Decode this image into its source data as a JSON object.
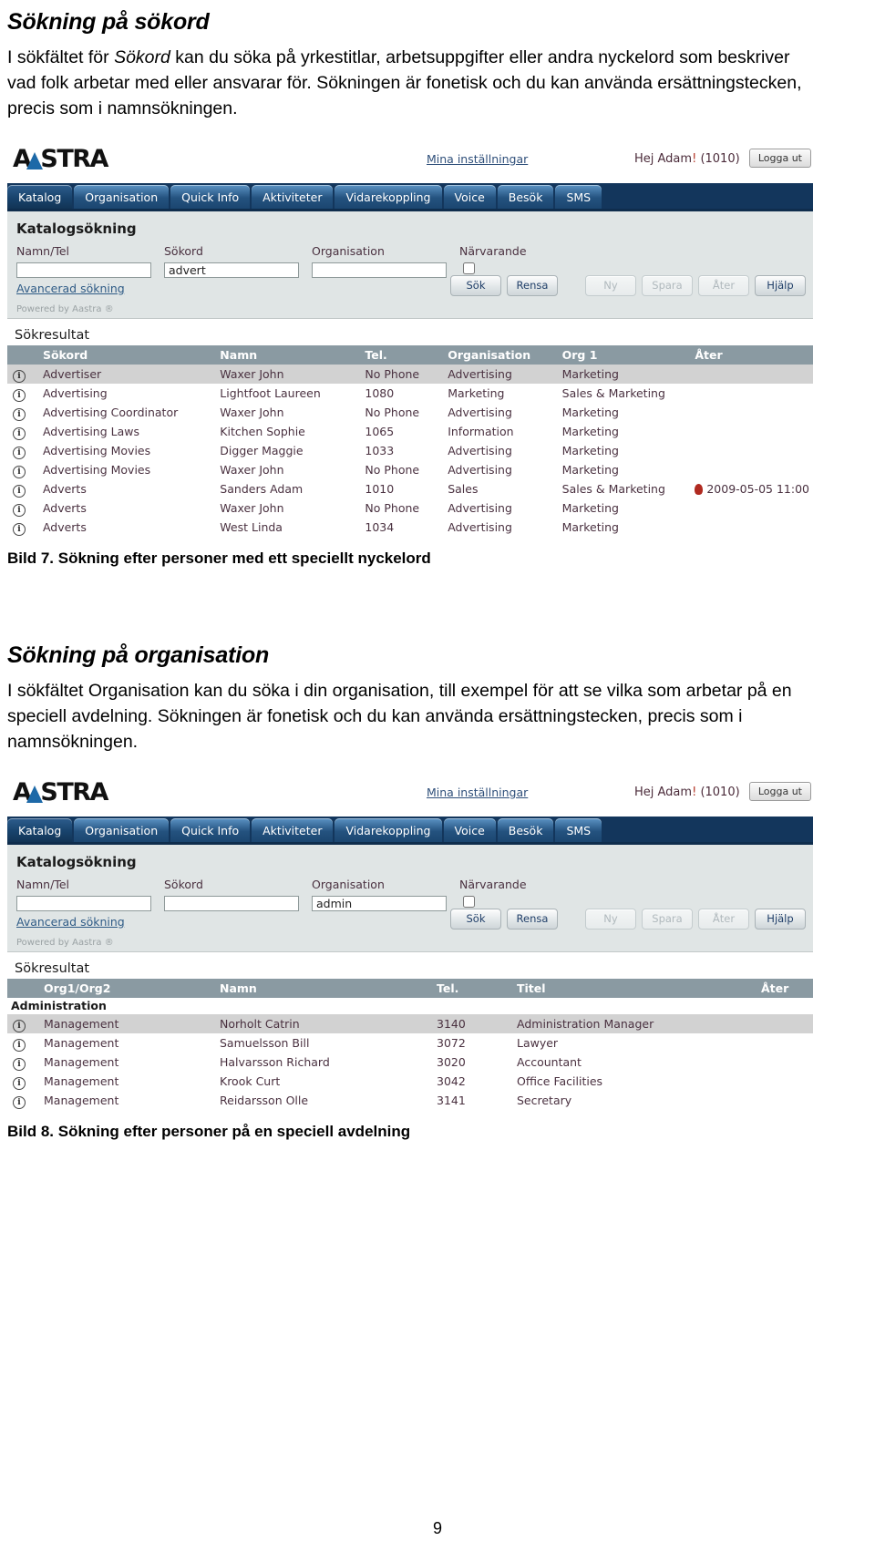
{
  "sections": [
    {
      "heading": "Sökning på sökord",
      "paragraph_html": "I sökfältet för <em>Sökord</em> kan du söka på yrkestitlar, arbetsuppgifter eller andra nyckelord som beskriver vad folk arbetar med eller ansvarar för. Sökningen är fonetisk och du kan använda ersättningstecken, precis som i namnsökningen.",
      "caption": "Bild 7. Sökning efter personer med ett speciellt nyckelord"
    },
    {
      "heading": "Sökning på organisation",
      "paragraph_html": "I sökfältet Organisation kan du söka i din organisation, till exempel för att se vilka som arbetar på en speciell avdelning. Sökningen är fonetisk och du kan använda ersättningstecken, precis som i namnsökningen.",
      "caption": "Bild 8. Sökning efter personer på en speciell avdelning"
    }
  ],
  "app": {
    "logo_left": "A",
    "logo_right": "STRA",
    "my_settings_link": "Mina inställningar",
    "greeting_prefix": "Hej Adam",
    "greeting_bang": "!",
    "greeting_ext": "(1010)",
    "logout_label": "Logga ut",
    "tabs": [
      {
        "label": "Katalog",
        "active": true
      },
      {
        "label": "Organisation",
        "active": false
      },
      {
        "label": "Quick Info",
        "active": false
      },
      {
        "label": "Aktiviteter",
        "active": false
      },
      {
        "label": "Vidarekoppling",
        "active": false
      },
      {
        "label": "Voice",
        "active": false
      },
      {
        "label": "Besök",
        "active": false
      },
      {
        "label": "SMS",
        "active": false
      }
    ],
    "panel_title": "Katalogsökning",
    "labels": {
      "namn_tel": "Namn/Tel",
      "sokord": "Sökord",
      "organisation": "Organisation",
      "narvarande": "Närvarande"
    },
    "advanced_link": "Avancerad sökning",
    "buttons": {
      "sok": "Sök",
      "rensa": "Rensa",
      "ny": "Ny",
      "spara": "Spara",
      "ater": "Åter",
      "hjalp": "Hjälp"
    },
    "powered_by": "Powered by Aastra ®",
    "results_title": "Sökresultat"
  },
  "screenshot1": {
    "values": {
      "namn_tel": "",
      "sokord": "advert",
      "organisation": ""
    },
    "columns": [
      "Sökord",
      "Namn",
      "Tel.",
      "Organisation",
      "Org 1",
      "Åter"
    ],
    "rows": [
      {
        "icon": "info-icon",
        "sokord": "Advertiser",
        "namn": "Waxer John",
        "tel": "No Phone",
        "organisation": "Advertising",
        "org1": "Marketing",
        "ater": "",
        "pin": false,
        "alt": true
      },
      {
        "icon": "info-icon",
        "sokord": "Advertising",
        "namn": "Lightfoot Laureen",
        "tel": "1080",
        "organisation": "Marketing",
        "org1": "Sales & Marketing",
        "ater": "",
        "pin": false,
        "alt": false
      },
      {
        "icon": "info-icon",
        "sokord": "Advertising Coordinator",
        "namn": "Waxer John",
        "tel": "No Phone",
        "organisation": "Advertising",
        "org1": "Marketing",
        "ater": "",
        "pin": false,
        "alt": false
      },
      {
        "icon": "info-icon",
        "sokord": "Advertising Laws",
        "namn": "Kitchen Sophie",
        "tel": "1065",
        "organisation": "Information",
        "org1": "Marketing",
        "ater": "",
        "pin": false,
        "alt": false
      },
      {
        "icon": "info-icon",
        "sokord": "Advertising Movies",
        "namn": "Digger Maggie",
        "tel": "1033",
        "organisation": "Advertising",
        "org1": "Marketing",
        "ater": "",
        "pin": false,
        "alt": false
      },
      {
        "icon": "info-icon",
        "sokord": "Advertising Movies",
        "namn": "Waxer John",
        "tel": "No Phone",
        "organisation": "Advertising",
        "org1": "Marketing",
        "ater": "",
        "pin": false,
        "alt": false
      },
      {
        "icon": "info-icon",
        "sokord": "Adverts",
        "namn": "Sanders Adam",
        "tel": "1010",
        "organisation": "Sales",
        "org1": "Sales & Marketing",
        "ater": "2009-05-05 11:00",
        "pin": true,
        "alt": false
      },
      {
        "icon": "info-icon",
        "sokord": "Adverts",
        "namn": "Waxer John",
        "tel": "No Phone",
        "organisation": "Advertising",
        "org1": "Marketing",
        "ater": "",
        "pin": false,
        "alt": false
      },
      {
        "icon": "info-icon",
        "sokord": "Adverts",
        "namn": "West Linda",
        "tel": "1034",
        "organisation": "Advertising",
        "org1": "Marketing",
        "ater": "",
        "pin": false,
        "alt": false
      }
    ]
  },
  "screenshot2": {
    "values": {
      "namn_tel": "",
      "sokord": "",
      "organisation": "admin"
    },
    "columns": [
      "Org1/Org2",
      "Namn",
      "Tel.",
      "Titel",
      "Åter"
    ],
    "group_label": "Administration",
    "rows": [
      {
        "icon": "info-icon",
        "org": "Management",
        "namn": "Norholt Catrin",
        "tel": "3140",
        "titel": "Administration Manager",
        "ater": "",
        "alt": true
      },
      {
        "icon": "info-icon",
        "org": "Management",
        "namn": "Samuelsson Bill",
        "tel": "3072",
        "titel": "Lawyer",
        "ater": "",
        "alt": false
      },
      {
        "icon": "info-icon",
        "org": "Management",
        "namn": "Halvarsson Richard",
        "tel": "3020",
        "titel": "Accountant",
        "ater": "",
        "alt": false
      },
      {
        "icon": "info-icon",
        "org": "Management",
        "namn": "Krook Curt",
        "tel": "3042",
        "titel": "Office Facilities",
        "ater": "",
        "alt": false
      },
      {
        "icon": "info-icon",
        "org": "Management",
        "namn": "Reidarsson Olle",
        "tel": "3141",
        "titel": "Secretary",
        "ater": "",
        "alt": false
      }
    ]
  },
  "page_number": "9"
}
